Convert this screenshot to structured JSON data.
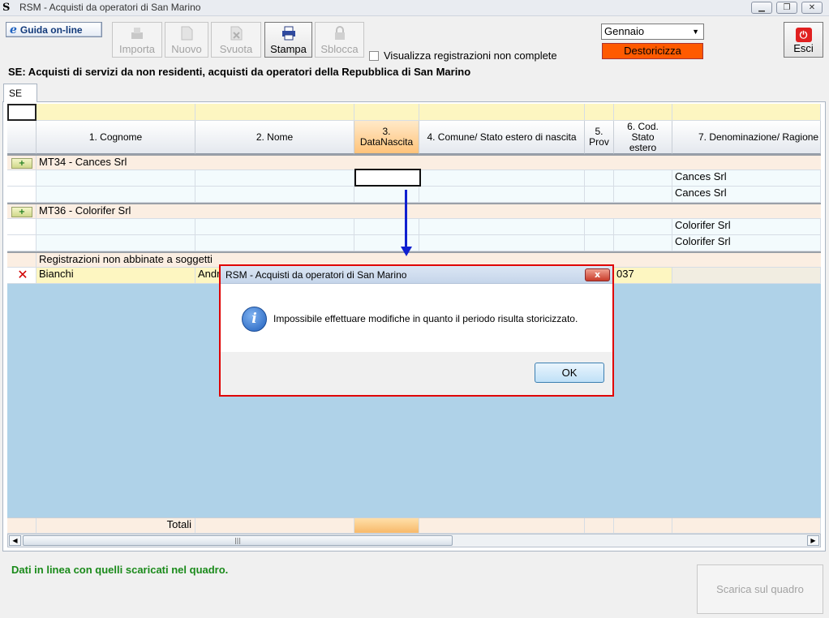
{
  "window": {
    "title": "RSM - Acquisti da operatori di San Marino",
    "icon": "S"
  },
  "toolbar": {
    "guida": "Guida on-line",
    "importa": "Importa",
    "nuovo": "Nuovo",
    "svuota": "Svuota",
    "stampa": "Stampa",
    "sblocca": "Sblocca",
    "checkbox_label": "Visualizza registrazioni non complete",
    "month": "Gennaio",
    "destoricizza": "Destoricizza",
    "esci": "Esci"
  },
  "section_title": "SE: Acquisti di servizi da non residenti, acquisti da operatori della Repubblica di San Marino",
  "tab": "SE",
  "grid": {
    "headers": {
      "c1": "1. Cognome",
      "c2": "2. Nome",
      "c3a": "3.",
      "c3b": "DataNascita",
      "c4": "4. Comune/ Stato estero di nascita",
      "c5a": "5.",
      "c5b": "Prov",
      "c6a": "6. Cod.",
      "c6b": "Stato",
      "c6c": "estero",
      "c7": "7. Denominazione/ Ragione"
    },
    "group1": {
      "label": "MT34 - Cances Srl",
      "r1": "Cances Srl",
      "r2": "Cances Srl"
    },
    "group2": {
      "label": "MT36 - Colorifer Srl",
      "r1": "Colorifer Srl",
      "r2": "Colorifer Srl"
    },
    "unmatched": {
      "label": "Registrazioni non abbinate a soggetti",
      "cognome": "Bianchi",
      "nome": "Andr",
      "cod": "037"
    },
    "totali": "Totali"
  },
  "status": "Dati in linea con quelli scaricati nel quadro.",
  "scarica": "Scarica sul quadro",
  "dialog": {
    "title": "RSM - Acquisti da operatori di San Marino",
    "close": "x",
    "message": "Impossibile effettuare modifiche in quanto il periodo risulta storicizzato.",
    "ok": "OK"
  },
  "colors": {
    "highlight": "#e00000",
    "arrow": "#1020d0",
    "destoricizza": "#ff5a00",
    "status": "#1a8a1a"
  }
}
